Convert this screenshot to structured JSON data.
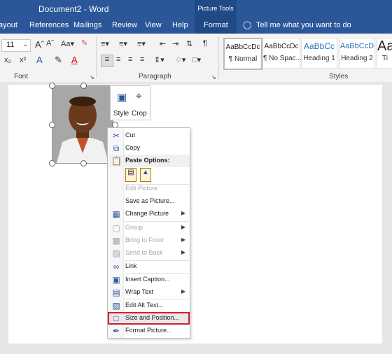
{
  "titlebar": {
    "document": "Document2 - Word",
    "context_tab_group": "Picture Tools"
  },
  "tabs": [
    "ayout",
    "References",
    "Mailings",
    "Review",
    "View",
    "Help",
    "Format",
    "Tell me what you want to do"
  ],
  "ribbon": {
    "font_size": "11",
    "groups": [
      "Font",
      "Paragraph",
      "Styles"
    ],
    "styles": [
      {
        "sample": "AaBbCcDc",
        "name": "¶ Normal"
      },
      {
        "sample": "AaBbCcDc",
        "name": "¶ No Spac..."
      },
      {
        "sample": "AaBbCc",
        "name": "Heading 1"
      },
      {
        "sample": "AaBbCcD",
        "name": "Heading 2"
      },
      {
        "sample": "Aa",
        "name": "Ti"
      }
    ]
  },
  "minibar": {
    "style_label": "Style",
    "crop_label": "Crop"
  },
  "context_menu": {
    "items": [
      {
        "label": "Cut",
        "icon": "scissors-icon",
        "enabled": true
      },
      {
        "label": "Copy",
        "icon": "copy-icon",
        "enabled": true
      },
      {
        "label": "Paste Options:",
        "icon": "paste-icon",
        "enabled": true,
        "header": true
      },
      {
        "label": "Edit Picture",
        "enabled": false
      },
      {
        "label": "Save as Picture...",
        "enabled": true
      },
      {
        "label": "Change Picture",
        "icon": "change-picture-icon",
        "enabled": true,
        "submenu": true
      },
      {
        "label": "Group",
        "icon": "group-icon",
        "enabled": false,
        "submenu": true
      },
      {
        "label": "Bring to Front",
        "icon": "bring-front-icon",
        "enabled": false,
        "submenu": true
      },
      {
        "label": "Send to Back",
        "icon": "send-back-icon",
        "enabled": false,
        "submenu": true
      },
      {
        "label": "Link",
        "icon": "link-icon",
        "enabled": true
      },
      {
        "label": "Insert Caption...",
        "icon": "caption-icon",
        "enabled": true
      },
      {
        "label": "Wrap Text",
        "icon": "wrap-text-icon",
        "enabled": true,
        "submenu": true
      },
      {
        "label": "Edit Alt Text...",
        "icon": "alt-text-icon",
        "enabled": true
      },
      {
        "label": "Size and Position...",
        "icon": "size-position-icon",
        "enabled": true,
        "highlighted": true
      },
      {
        "label": "Format Picture...",
        "icon": "format-picture-icon",
        "enabled": true
      }
    ]
  },
  "colors": {
    "brand": "#2b579a",
    "highlight_border": "#d6202a"
  }
}
